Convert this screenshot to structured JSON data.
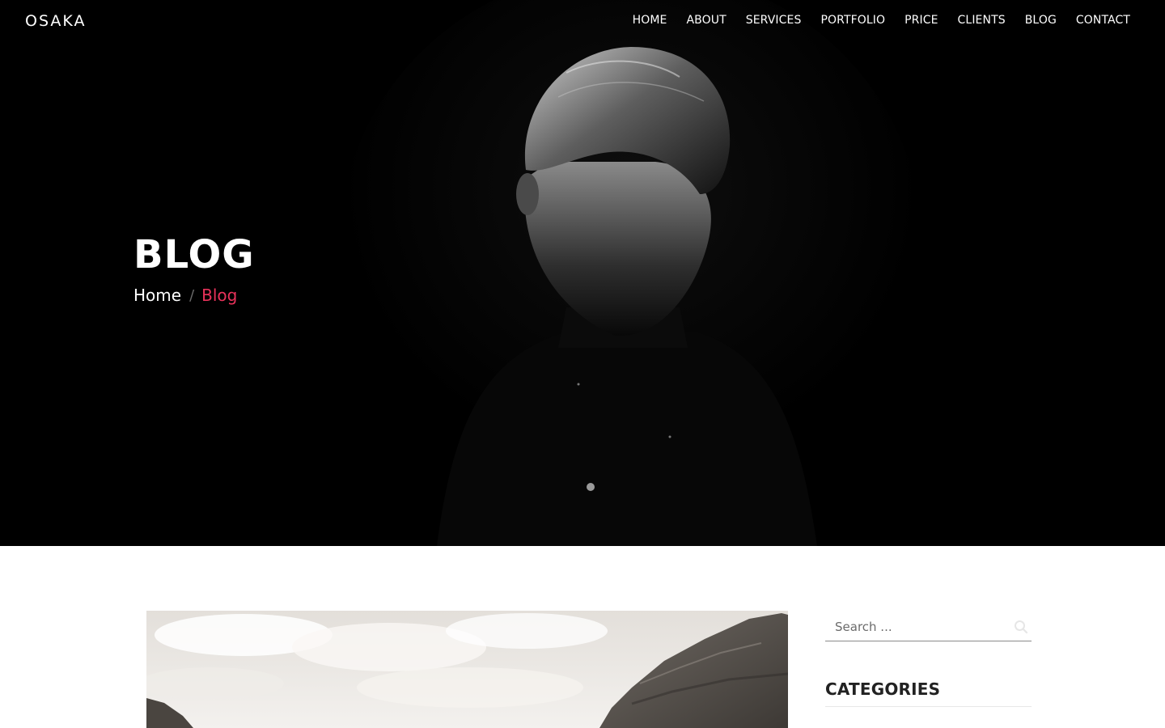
{
  "brand": {
    "name": "OSAKA"
  },
  "nav": {
    "items": [
      "HOME",
      "ABOUT",
      "SERVICES",
      "PORTFOLIO",
      "PRICE",
      "CLIENTS",
      "BLOG",
      "CONTACT"
    ]
  },
  "hero": {
    "title": "BLOG",
    "breadcrumb": {
      "home": "Home",
      "separator": "/",
      "current": "Blog"
    }
  },
  "sidebar": {
    "search": {
      "placeholder": "Search ...",
      "value": ""
    },
    "categories_title": "CATEGORIES"
  },
  "colors": {
    "accent": "#e8325a",
    "hero_background": "#000000",
    "page_background": "#ffffff"
  }
}
